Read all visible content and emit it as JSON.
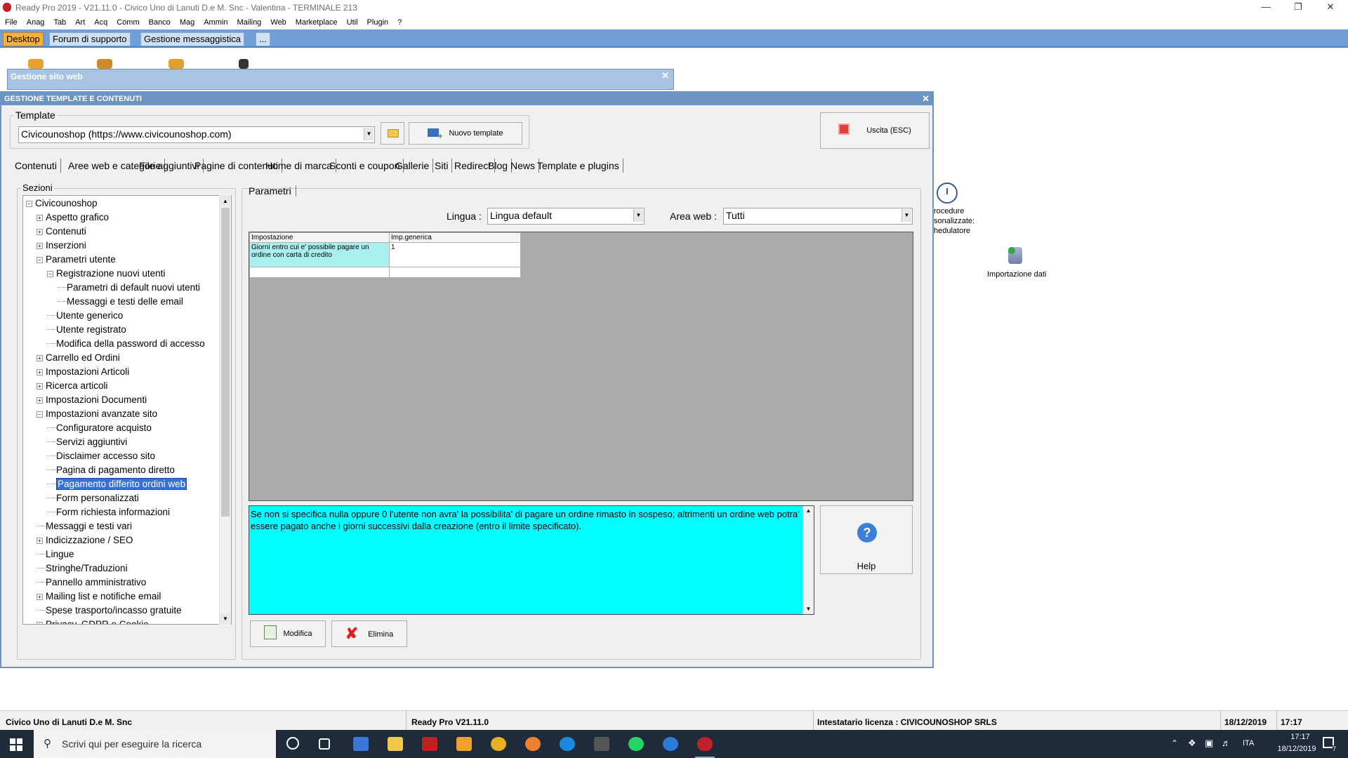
{
  "app": {
    "title": "Ready Pro 2019 - V21.11.0 - Civico Uno di Lanuti D.e M. Snc - Valentina - TERMINALE 213",
    "menu": [
      "File",
      "Anag",
      "Tab",
      "Art",
      "Acq",
      "Comm",
      "Banco",
      "Mag",
      "Ammin",
      "Mailing",
      "Web",
      "Marketplace",
      "Util",
      "Plugin",
      "?"
    ],
    "tabs": [
      "Desktop",
      "Forum di supporto",
      "Gestione messaggistica",
      "..."
    ]
  },
  "bg_window": {
    "title": "Gestione sito web"
  },
  "dialog": {
    "title": "GESTIONE TEMPLATE E CONTENUTI",
    "template_label": "Template",
    "template_value": "Civicounoshop (https://www.civicounoshop.com)",
    "new_template_button": "Nuovo template",
    "exit_button": "Uscita (ESC)",
    "tabs": [
      "Contenuti",
      "Aree web e categorie",
      "File aggiuntivi",
      "Pagine di contenuti",
      "Home di marca",
      "Sconti e coupon",
      "Gallerie",
      "Siti",
      "Redirect",
      "Blog",
      "News",
      "Template e plugins"
    ],
    "sections_label": "Sezioni",
    "tree": [
      {
        "label": "Civicounoshop",
        "level": 0,
        "toggle": "⊟"
      },
      {
        "label": "Aspetto grafico",
        "level": 1,
        "toggle": "⊞"
      },
      {
        "label": "Contenuti",
        "level": 1,
        "toggle": "⊞"
      },
      {
        "label": "Inserzioni",
        "level": 1,
        "toggle": "⊞"
      },
      {
        "label": "Parametri utente",
        "level": 1,
        "toggle": "⊟"
      },
      {
        "label": "Registrazione nuovi utenti",
        "level": 2,
        "toggle": "⊟"
      },
      {
        "label": "Parametri di default nuovi utenti",
        "level": 3,
        "toggle": ""
      },
      {
        "label": "Messaggi e testi delle email",
        "level": 3,
        "toggle": ""
      },
      {
        "label": "Utente generico",
        "level": 2,
        "toggle": ""
      },
      {
        "label": "Utente registrato",
        "level": 2,
        "toggle": ""
      },
      {
        "label": "Modifica della password di accesso",
        "level": 2,
        "toggle": ""
      },
      {
        "label": "Carrello ed Ordini",
        "level": 1,
        "toggle": "⊞"
      },
      {
        "label": "Impostazioni Articoli",
        "level": 1,
        "toggle": "⊞"
      },
      {
        "label": "Ricerca articoli",
        "level": 1,
        "toggle": "⊞"
      },
      {
        "label": "Impostazioni Documenti",
        "level": 1,
        "toggle": "⊞"
      },
      {
        "label": "Impostazioni avanzate sito",
        "level": 1,
        "toggle": "⊟"
      },
      {
        "label": "Configuratore acquisto",
        "level": 2,
        "toggle": ""
      },
      {
        "label": "Servizi aggiuntivi",
        "level": 2,
        "toggle": ""
      },
      {
        "label": "Disclaimer accesso sito",
        "level": 2,
        "toggle": ""
      },
      {
        "label": "Pagina di pagamento diretto",
        "level": 2,
        "toggle": ""
      },
      {
        "label": "Pagamento differito ordini web",
        "level": 2,
        "toggle": "",
        "selected": true
      },
      {
        "label": "Form personalizzati",
        "level": 2,
        "toggle": ""
      },
      {
        "label": "Form richiesta informazioni",
        "level": 2,
        "toggle": ""
      },
      {
        "label": "Messaggi e testi vari",
        "level": 1,
        "toggle": ""
      },
      {
        "label": "Indicizzazione / SEO",
        "level": 1,
        "toggle": "⊞"
      },
      {
        "label": "Lingue",
        "level": 1,
        "toggle": ""
      },
      {
        "label": "Stringhe/Traduzioni",
        "level": 1,
        "toggle": ""
      },
      {
        "label": "Pannello amministrativo",
        "level": 1,
        "toggle": ""
      },
      {
        "label": "Mailing list e notifiche email",
        "level": 1,
        "toggle": "⊞"
      },
      {
        "label": "Spese trasporto/incasso gratuite",
        "level": 1,
        "toggle": ""
      },
      {
        "label": "Privacy, GDPR e Cookie",
        "level": 1,
        "toggle": "⊞"
      }
    ],
    "params_tab": "Parametri",
    "lingua_label": "Lingua :",
    "lingua_value": "Lingua default",
    "area_label": "Area web :",
    "area_value": "Tutti",
    "grid_headers": [
      "Impostazione",
      "Imp.generica"
    ],
    "grid_rows": [
      {
        "setting": "Giorni entro cui e' possibile pagare un ordine con carta di credito",
        "value": "1"
      }
    ],
    "description": "Se non si specifica nulla oppure 0 l'utente non avra' la possibilita' di pagare un ordine rimasto in sospeso; altrimenti un ordine web potra' essere pagato anche i giorni successivi dalla creazione (entro il limite specificato).",
    "help_button": "Help",
    "edit_button": "Modifica",
    "delete_button": "Elimina"
  },
  "desktop_icons": {
    "procedure_label": "rocedure\nsonalizzate:\nhedulatore",
    "import_label": "Importazione dati"
  },
  "status": {
    "company": "Civico Uno di Lanuti D.e M. Snc",
    "version": "Ready Pro V21.11.0",
    "license": "Intestatario licenza : CIVICOUNOSHOP SRLS",
    "date": "18/12/2019",
    "time": "17:17"
  },
  "taskbar": {
    "search_placeholder": "Scrivi qui per eseguire la ricerca",
    "lang": "ITA",
    "clock_time": "17:17",
    "clock_date": "18/12/2019",
    "notif_count": "7"
  }
}
